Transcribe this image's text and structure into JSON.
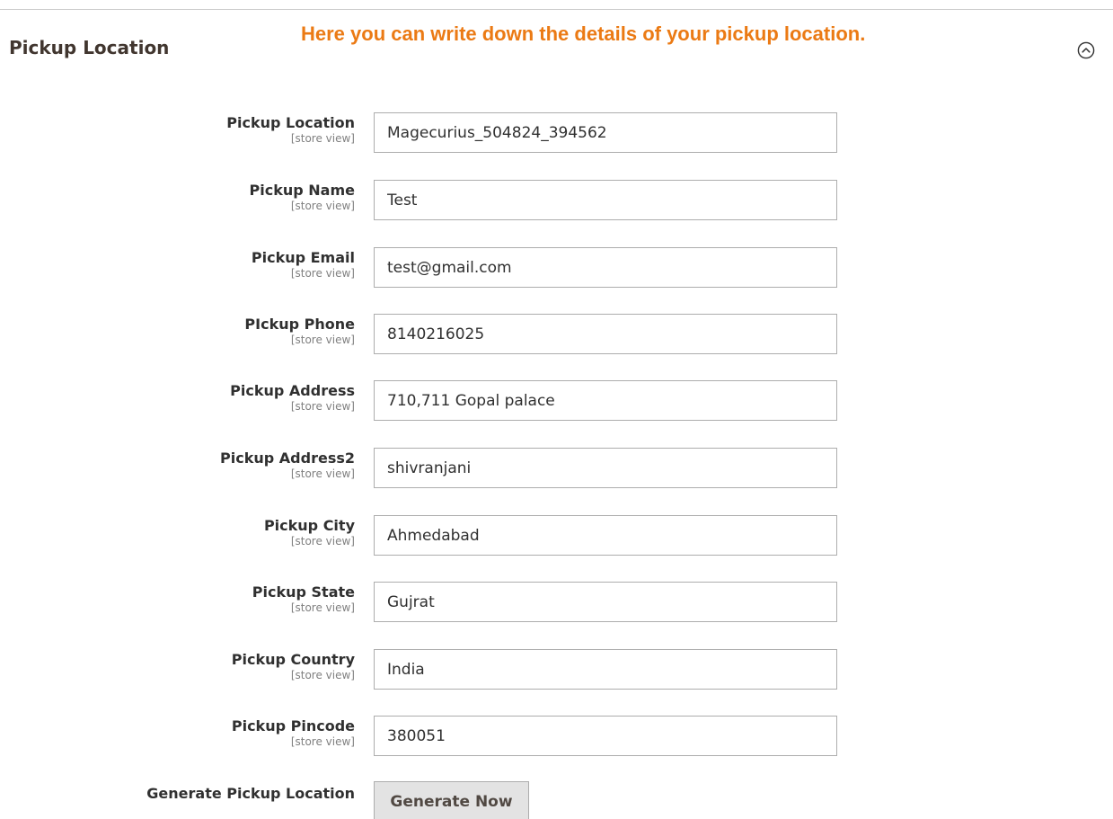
{
  "section": {
    "title": "Pickup Location",
    "annotation": "Here you can write down the details of your pickup location."
  },
  "fields": [
    {
      "label": "Pickup Location",
      "scope": "[store view]",
      "value": "Magecurius_504824_394562"
    },
    {
      "label": "Pickup Name",
      "scope": "[store view]",
      "value": "Test"
    },
    {
      "label": "Pickup Email",
      "scope": "[store view]",
      "value": "test@gmail.com"
    },
    {
      "label": "PIckup Phone",
      "scope": "[store view]",
      "value": "8140216025"
    },
    {
      "label": "Pickup Address",
      "scope": "[store view]",
      "value": "710,711 Gopal palace"
    },
    {
      "label": "Pickup Address2",
      "scope": "[store view]",
      "value": "shivranjani"
    },
    {
      "label": "Pickup City",
      "scope": "[store view]",
      "value": "Ahmedabad"
    },
    {
      "label": "Pickup State",
      "scope": "[store view]",
      "value": "Gujrat"
    },
    {
      "label": "Pickup Country",
      "scope": "[store view]",
      "value": "India"
    },
    {
      "label": "Pickup Pincode",
      "scope": "[store view]",
      "value": "380051"
    }
  ],
  "generate": {
    "label": "Generate Pickup Location",
    "button_label": "Generate Now"
  },
  "icons": {
    "collapse": "chevron-up-circle-icon"
  }
}
